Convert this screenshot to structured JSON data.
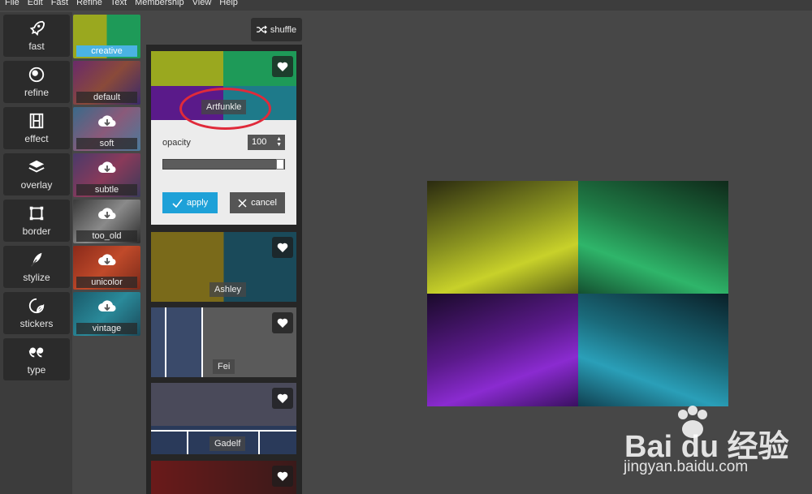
{
  "menubar": [
    "File",
    "Edit",
    "Fast",
    "Refine",
    "Text",
    "Membership",
    "View",
    "Help"
  ],
  "tools": [
    {
      "label": "fast",
      "icon": "rocket-icon"
    },
    {
      "label": "refine",
      "icon": "refine-circles-icon"
    },
    {
      "label": "effect",
      "icon": "film-icon"
    },
    {
      "label": "overlay",
      "icon": "layers-icon"
    },
    {
      "label": "border",
      "icon": "border-square-icon"
    },
    {
      "label": "stylize",
      "icon": "feather-icon"
    },
    {
      "label": "stickers",
      "icon": "sticker-icon"
    },
    {
      "label": "type",
      "icon": "quote-icon"
    }
  ],
  "presets": [
    {
      "label": "creative",
      "active": true
    },
    {
      "label": "default",
      "active": false
    },
    {
      "label": "soft",
      "active": false
    },
    {
      "label": "subtle",
      "active": false
    },
    {
      "label": "too_old",
      "active": false
    },
    {
      "label": "unicolor",
      "active": false
    },
    {
      "label": "vintage",
      "active": false
    }
  ],
  "panel": {
    "shuffle_label": "shuffle",
    "selected_effect": "Artfunkle",
    "opacity_label": "opacity",
    "opacity_value": "100",
    "opacity_fraction": 1.0,
    "apply_label": "apply",
    "cancel_label": "cancel",
    "effects": [
      "Ashley",
      "Fei",
      "Gadelf"
    ]
  },
  "watermark": {
    "main": "Bai du 经验",
    "url": "jingyan.baidu.com"
  },
  "colors": {
    "accent": "#1ea1d8",
    "annotation": "#e02a3a",
    "quad_tl": "#c8d12a",
    "quad_tr": "#2fb56a",
    "quad_bl": "#8a2bd0",
    "quad_br": "#2a9fb8"
  }
}
